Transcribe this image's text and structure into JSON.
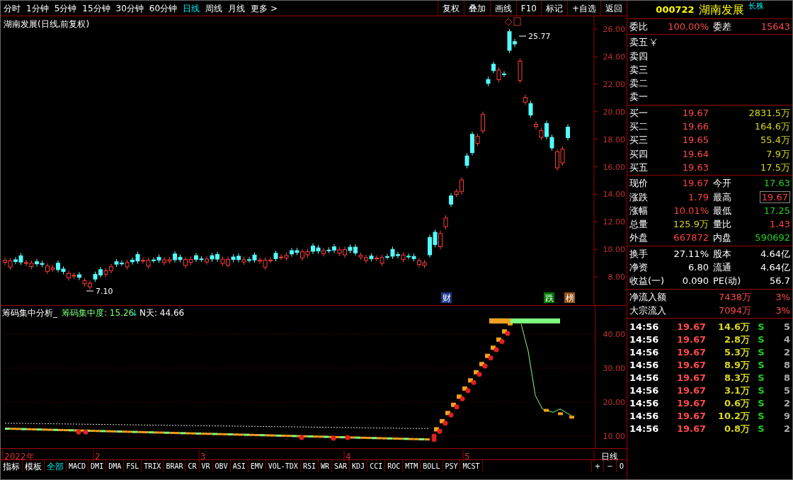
{
  "toolbar": {
    "periods": [
      {
        "label": "分时",
        "selected": false
      },
      {
        "label": "1分钟",
        "selected": false
      },
      {
        "label": "5分钟",
        "selected": false
      },
      {
        "label": "15分钟",
        "selected": false
      },
      {
        "label": "30分钟",
        "selected": false
      },
      {
        "label": "60分钟",
        "selected": false
      },
      {
        "label": "日线",
        "selected": true
      },
      {
        "label": "周线",
        "selected": false
      },
      {
        "label": "月线",
        "selected": false
      },
      {
        "label": "更多 >",
        "selected": false
      }
    ],
    "actions": [
      "复权",
      "叠加",
      "画线",
      "F10",
      "标记",
      "+自选",
      "返回"
    ]
  },
  "chart": {
    "title": "湖南发展(日线,前复权)",
    "price_ticks": [
      "26.00",
      "24.00",
      "22.00",
      "20.00",
      "18.00",
      "16.00",
      "14.00",
      "12.00",
      "10.00",
      "8.00"
    ],
    "high_label": "25.77",
    "low_label": "7.10",
    "markers": [
      {
        "label": "财",
        "color": "#1e3c8c"
      },
      {
        "label": "跌",
        "color": "#007800"
      },
      {
        "label": "榜",
        "color": "#965014"
      }
    ]
  },
  "indicator": {
    "name": "筹码集中分析_",
    "series_label": "筹码集中度: 15.26",
    "arrow": "↓",
    "n_label": "N天: 44.66",
    "ticks": [
      "40.00",
      "30.00",
      "20.00",
      "10.00"
    ]
  },
  "date_axis": [
    "2022年",
    "2",
    "3",
    "4",
    "5"
  ],
  "period_label": "日线",
  "zoom_buttons": [
    "+",
    "−",
    "0"
  ],
  "indicator_tabs": [
    {
      "label": "指标",
      "selected": false
    },
    {
      "label": "模板",
      "selected": false
    },
    {
      "label": "全部",
      "selected": true
    },
    {
      "label": "MACD",
      "selected": false
    },
    {
      "label": "DMI",
      "selected": false
    },
    {
      "label": "DMA",
      "selected": false
    },
    {
      "label": "FSL",
      "selected": false
    },
    {
      "label": "TRIX",
      "selected": false
    },
    {
      "label": "BRAR",
      "selected": false
    },
    {
      "label": "CR",
      "selected": false
    },
    {
      "label": "VR",
      "selected": false
    },
    {
      "label": "OBV",
      "selected": false
    },
    {
      "label": "ASI",
      "selected": false
    },
    {
      "label": "EMV",
      "selected": false
    },
    {
      "label": "VOL-TDX",
      "selected": false
    },
    {
      "label": "RSI",
      "selected": false
    },
    {
      "label": "WR",
      "selected": false
    },
    {
      "label": "SAR",
      "selected": false
    },
    {
      "label": "KDJ",
      "selected": false
    },
    {
      "label": "CCI",
      "selected": false
    },
    {
      "label": "ROC",
      "selected": false
    },
    {
      "label": "MTM",
      "selected": false
    },
    {
      "label": "BOLL",
      "selected": false
    },
    {
      "label": "PSY",
      "selected": false
    },
    {
      "label": "MCST",
      "selected": false
    }
  ],
  "quote": {
    "code": "000722",
    "name": "湖南发展",
    "tag": "长株",
    "ratio": {
      "label": "委比",
      "value": "100.00%",
      "label2": "委差",
      "value2": "15643"
    },
    "sell": [
      "卖五",
      "卖四",
      "卖三",
      "卖二",
      "卖一"
    ],
    "buy": [
      {
        "label": "买一",
        "price": "19.67",
        "volume": "2831.5万"
      },
      {
        "label": "买二",
        "price": "19.66",
        "volume": "164.6万"
      },
      {
        "label": "买三",
        "price": "19.65",
        "volume": "55.4万"
      },
      {
        "label": "买四",
        "price": "19.64",
        "volume": "7.9万"
      },
      {
        "label": "买五",
        "price": "19.63",
        "volume": "17.5万"
      }
    ],
    "stats": [
      {
        "left": {
          "label": "现价",
          "value": "19.67",
          "color": "#ff4040",
          "highlighted": false
        },
        "right": {
          "label": "今开",
          "value": "17.63",
          "color": "#20d020",
          "highlighted": false
        }
      },
      {
        "left": {
          "label": "涨跌",
          "value": "1.79",
          "color": "#ff4040",
          "highlighted": false
        },
        "right": {
          "label": "最高",
          "value": "19.67",
          "color": "#ff4040",
          "highlighted": true
        }
      },
      {
        "left": {
          "label": "涨幅",
          "value": "10.01%",
          "color": "#ff4040",
          "highlighted": false
        },
        "right": {
          "label": "最低",
          "value": "17.25",
          "color": "#20d020",
          "highlighted": false
        }
      },
      {
        "left": {
          "label": "总量",
          "value": "125.9万",
          "color": "#d0d020",
          "highlighted": false
        },
        "right": {
          "label": "量比",
          "value": "1.43",
          "color": "#ff4040",
          "highlighted": false
        }
      },
      {
        "left": {
          "label": "外盘",
          "value": "667872",
          "color": "#ff4040",
          "highlighted": false
        },
        "right": {
          "label": "内盘",
          "value": "590692",
          "color": "#20d020",
          "highlighted": false
        }
      }
    ],
    "fundamentals": [
      {
        "label": "换手",
        "value": "27.11%",
        "label2": "股本",
        "value2": "4.64亿"
      },
      {
        "label": "净资",
        "value": "6.80",
        "label2": "流通",
        "value2": "4.64亿"
      },
      {
        "label": "收益(一)",
        "value": "0.090",
        "label2": "PE(动)",
        "value2": "56.7"
      }
    ],
    "flows": [
      {
        "label": "净流入额",
        "value": "7438万",
        "pct": "3%"
      },
      {
        "label": "大宗流入",
        "value": "7094万",
        "pct": "3%"
      }
    ],
    "trades": [
      {
        "time": "14:56",
        "price": "19.67",
        "volume": "14.6万",
        "side": "S",
        "count": "5"
      },
      {
        "time": "14:56",
        "price": "19.67",
        "volume": "2.8万",
        "side": "S",
        "count": "4"
      },
      {
        "time": "14:56",
        "price": "19.67",
        "volume": "5.3万",
        "side": "S",
        "count": "2"
      },
      {
        "time": "14:56",
        "price": "19.67",
        "volume": "8.9万",
        "side": "S",
        "count": "8"
      },
      {
        "time": "14:56",
        "price": "19.67",
        "volume": "8.3万",
        "side": "S",
        "count": "8"
      },
      {
        "time": "14:56",
        "price": "19.67",
        "volume": "3.1万",
        "side": "S",
        "count": "5"
      },
      {
        "time": "14:56",
        "price": "19.67",
        "volume": "0.6万",
        "side": "S",
        "count": "2"
      },
      {
        "time": "14:56",
        "price": "19.67",
        "volume": "10.2万",
        "side": "S",
        "count": "9"
      },
      {
        "time": "14:56",
        "price": "19.67",
        "volume": "0.8万",
        "side": "S",
        "count": "2"
      }
    ]
  }
}
